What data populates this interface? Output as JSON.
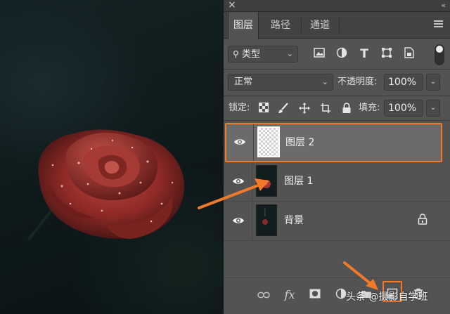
{
  "window": {
    "close_glyph": "×",
    "collapse_glyph": "‹‹"
  },
  "tabs": [
    {
      "label": "图层",
      "active": true
    },
    {
      "label": "路径",
      "active": false
    },
    {
      "label": "通道",
      "active": false
    }
  ],
  "filter": {
    "kind_label": "类型",
    "icons": [
      "image-filter-icon",
      "adjustment-filter-icon",
      "type-filter-icon",
      "shape-filter-icon",
      "smart-object-filter-icon"
    ]
  },
  "blend": {
    "mode": "正常",
    "opacity_label": "不透明度:",
    "opacity_value": "100%"
  },
  "lock": {
    "label": "锁定:",
    "fill_label": "填充:",
    "fill_value": "100%"
  },
  "layers": [
    {
      "name": "图层 2",
      "selected": true,
      "thumbnail": "transparent"
    },
    {
      "name": "图层 1",
      "selected": false,
      "thumbnail": "rose"
    },
    {
      "name": "背景",
      "selected": false,
      "thumbnail": "rose-dark",
      "locked": true
    }
  ],
  "watermark": {
    "text": "头条 @摄影自学班"
  },
  "colors": {
    "accent": "#f07a2a",
    "panel": "#535353",
    "selected_layer": "#6b6b6b"
  }
}
